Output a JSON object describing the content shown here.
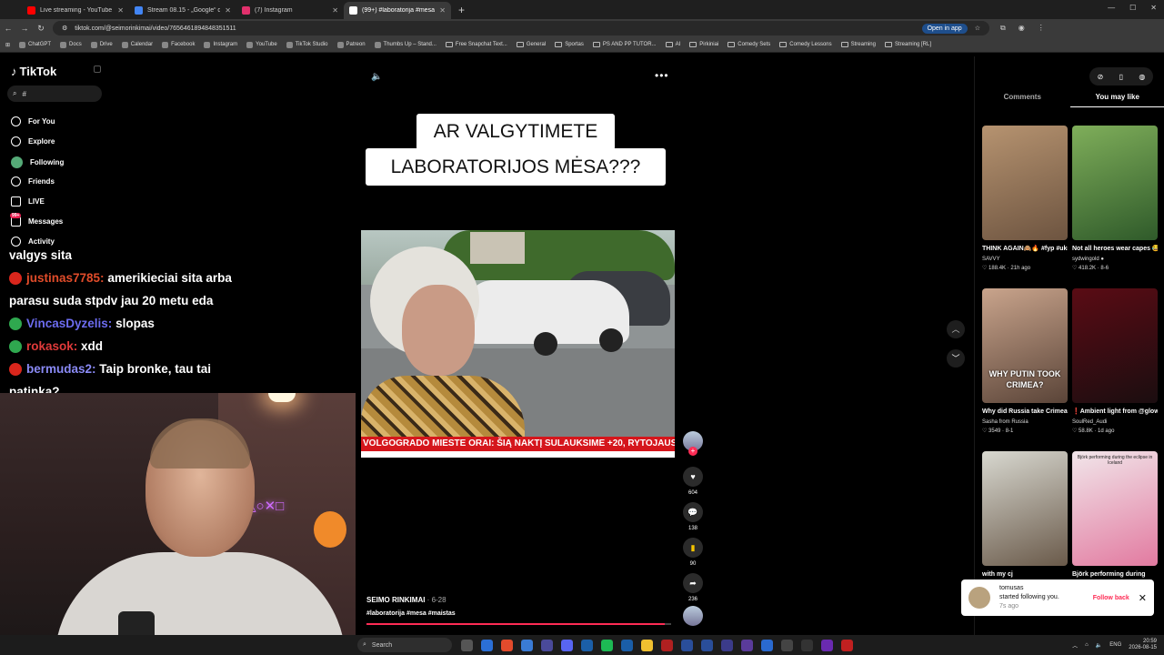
{
  "browser": {
    "tabs": [
      {
        "title": "Live streaming - YouTube Studi",
        "color": "#ff0000"
      },
      {
        "title": "Stream 08.15 - „Google“ dokum",
        "color": "#4285f4"
      },
      {
        "title": "(7) Instagram",
        "color": "#e1306c"
      },
      {
        "title": "(99+) #laboratorija #mesa #",
        "color": "#ffffff",
        "active": true
      }
    ],
    "url": "tiktok.com/@seimorinkimai/video/7656461894848351511",
    "open_in_app": "Open in app",
    "bookmarks": [
      "ChatGPT",
      "Docs",
      "Drive",
      "Calendar",
      "Facebook",
      "Instagram",
      "YouTube",
      "TikTok Studio",
      "Patreon",
      "Thumbs Up – Stand...",
      "Free Snapchat Text...",
      "General",
      "Sportas",
      "PS AND PP TUTOR...",
      "AI",
      "Pirkiniai",
      "Comedy Sets",
      "Comedy Lessons",
      "Streaming",
      "Streaming [RL]"
    ]
  },
  "tiktok": {
    "logo": "TikTok",
    "search_value": "#",
    "nav": [
      "For You",
      "Explore",
      "Following",
      "Friends",
      "LIVE",
      "Messages",
      "Activity"
    ],
    "messages_badge": "99+"
  },
  "chat": [
    {
      "user": "",
      "text": "valgys sita"
    },
    {
      "user": "justinas7785:",
      "text": "amerikieciai sita arba"
    },
    {
      "user": "",
      "text": "parasu suda stpdv jau 20 metu eda"
    },
    {
      "user": "VincasDyzelis:",
      "text": "slopas"
    },
    {
      "user": "rokasok:",
      "text": "xdd"
    },
    {
      "user": "bermudas2:",
      "text": "Taip bronke, tau tai"
    },
    {
      "user": "",
      "text": "patinka?"
    }
  ],
  "video": {
    "caption_line1": "AR VALGYTIMETE",
    "caption_line2": "LABORATORIJOS MĖSA???",
    "ticker": "VOLGOGRADO MIESTE   ORAI: ŠIĄ NAKTĮ SULAUKSIME +20, RYTOJAUS D",
    "author": "SEIMO RINKIMAI",
    "date": " · 6-28",
    "hashtags": "#laboratorija #mesa #maistas",
    "progress": 0.98,
    "likes": "604",
    "comments": "138",
    "saves": "90",
    "shares": "236"
  },
  "right_panel": {
    "tabs": [
      "Comments",
      "You may like"
    ],
    "active_tab": "You may like",
    "cards": [
      {
        "title": "THINK AGAIN🙈🔥 #fyp #ukmusic...",
        "author": "SAVVY",
        "meta": "♡ 188.4K · 21h ago",
        "overlay": "",
        "bg": "linear-gradient(160deg,#b69370,#6d5440)"
      },
      {
        "title": "Not all heroes wear capes 😂",
        "author": "sydwingold ●",
        "meta": "♡ 418.2K · 8-6",
        "overlay": "",
        "bg": "linear-gradient(160deg,#7fae5a,#2f5a2a)"
      },
      {
        "title": "Why did Russia take Crimea from Ukraine?...",
        "author": "Sasha from Russia",
        "meta": "♡ 3549 · 8-1",
        "overlay": "WHY PUTIN TOOK CRIMEA?",
        "bg": "linear-gradient(160deg,#c9a48c,#5a4438)"
      },
      {
        "title": "❗Ambient light from @glowridee Use code...",
        "author": "SoulRed_Audi",
        "meta": "♡ 58.8K · 1d ago",
        "overlay": "",
        "bg": "linear-gradient(160deg,#5a0c14,#1b0d10)"
      },
      {
        "title": "with my cj",
        "author": "",
        "meta": "",
        "overlay": "",
        "bg": "linear-gradient(160deg,#d8d8d0,#6a5a4a)"
      },
      {
        "title": "Björk performing during",
        "author": "",
        "meta": "",
        "overlay": "",
        "small_text": "Björk performing during the eclipse in Iceland",
        "bg": "linear-gradient(160deg,#f1e6ea,#e27aa0)"
      }
    ]
  },
  "toast": {
    "user": "tomusas",
    "text": "started following you.",
    "time": "7s ago",
    "action": "Follow back"
  },
  "taskbar": {
    "search": "Search",
    "lang": "ENG",
    "time": "20:59",
    "date": "2026-08-15"
  }
}
